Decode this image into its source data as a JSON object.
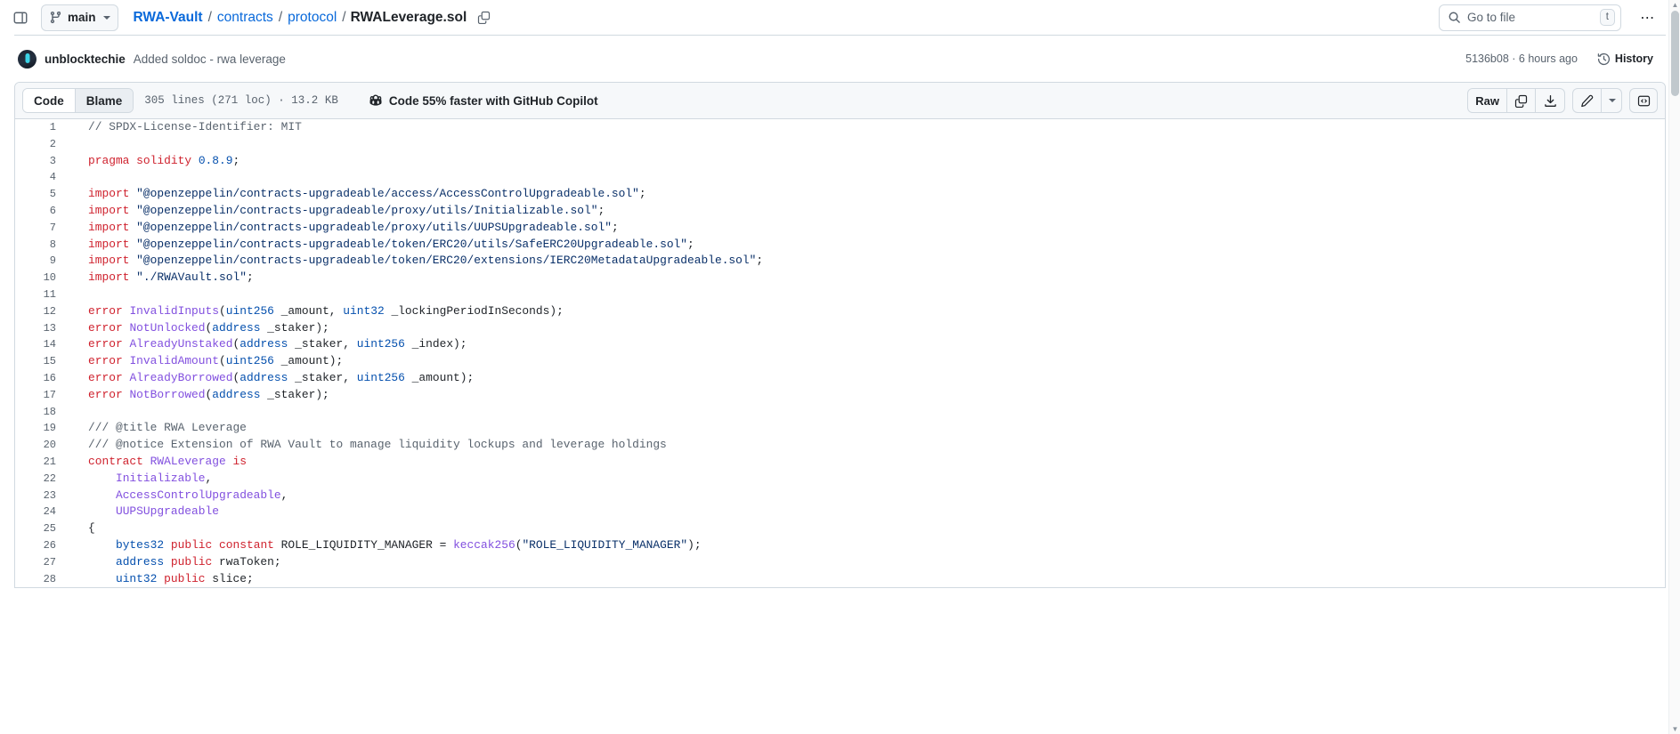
{
  "header": {
    "sidebar_toggle_name": "side-panel-icon",
    "branch": {
      "label": "main",
      "icon": "git-branch-icon"
    },
    "breadcrumb": {
      "repo": "RWA-Vault",
      "parts": [
        "contracts",
        "protocol"
      ],
      "file": "RWALeverage.sol",
      "separator": "/",
      "copy_icon": "copy-path-icon"
    },
    "search": {
      "placeholder": "Go to file",
      "shortcut": "t",
      "icon": "search-icon"
    },
    "more_label": "⋯"
  },
  "commit": {
    "author": "unblocktechie",
    "message": "Added soldoc - rwa leverage",
    "sha": "5136b08",
    "separator": "·",
    "relative_time": "6 hours ago",
    "meta": "5136b08 · 6 hours ago",
    "history_label": "History"
  },
  "file_toolbar": {
    "tabs": [
      {
        "label": "Code",
        "active": true
      },
      {
        "label": "Blame",
        "active": false
      }
    ],
    "file_meta": "305 lines (271 loc) · 13.2 KB",
    "lines_total": 305,
    "lines_loc": 271,
    "file_size": "13.2 KB",
    "copilot_banner": "Code 55% faster with GitHub Copilot",
    "actions": {
      "raw": "Raw",
      "copy": "copy-icon",
      "download": "download-icon",
      "edit": "pencil-icon",
      "edit_caret": "chevron-down-icon",
      "symbols": "code-braces-icon"
    }
  },
  "colors": {
    "accent": "#0969da",
    "keyword": "#cf222e",
    "string": "#0a3069",
    "number": "#0550ae",
    "type": "#0550ae",
    "function": "#8250df",
    "comment": "#59636e",
    "text": "#1f2328",
    "border": "#d1d9e0",
    "toolbar_bg": "#f6f8fa"
  },
  "code": {
    "language": "solidity",
    "start_line": 1,
    "lines": [
      [
        {
          "t": "cmt",
          "v": "// SPDX-License-Identifier: MIT"
        }
      ],
      [],
      [
        {
          "t": "kw",
          "v": "pragma"
        },
        {
          "t": "pln",
          "v": " "
        },
        {
          "t": "kw",
          "v": "solidity"
        },
        {
          "t": "pln",
          "v": " "
        },
        {
          "t": "num",
          "v": "0.8.9"
        },
        {
          "t": "pln",
          "v": ";"
        }
      ],
      [],
      [
        {
          "t": "kw",
          "v": "import"
        },
        {
          "t": "pln",
          "v": " "
        },
        {
          "t": "str",
          "v": "\"@openzeppelin/contracts-upgradeable/access/AccessControlUpgradeable.sol\""
        },
        {
          "t": "pln",
          "v": ";"
        }
      ],
      [
        {
          "t": "kw",
          "v": "import"
        },
        {
          "t": "pln",
          "v": " "
        },
        {
          "t": "str",
          "v": "\"@openzeppelin/contracts-upgradeable/proxy/utils/Initializable.sol\""
        },
        {
          "t": "pln",
          "v": ";"
        }
      ],
      [
        {
          "t": "kw",
          "v": "import"
        },
        {
          "t": "pln",
          "v": " "
        },
        {
          "t": "str",
          "v": "\"@openzeppelin/contracts-upgradeable/proxy/utils/UUPSUpgradeable.sol\""
        },
        {
          "t": "pln",
          "v": ";"
        }
      ],
      [
        {
          "t": "kw",
          "v": "import"
        },
        {
          "t": "pln",
          "v": " "
        },
        {
          "t": "str",
          "v": "\"@openzeppelin/contracts-upgradeable/token/ERC20/utils/SafeERC20Upgradeable.sol\""
        },
        {
          "t": "pln",
          "v": ";"
        }
      ],
      [
        {
          "t": "kw",
          "v": "import"
        },
        {
          "t": "pln",
          "v": " "
        },
        {
          "t": "str",
          "v": "\"@openzeppelin/contracts-upgradeable/token/ERC20/extensions/IERC20MetadataUpgradeable.sol\""
        },
        {
          "t": "pln",
          "v": ";"
        }
      ],
      [
        {
          "t": "kw",
          "v": "import"
        },
        {
          "t": "pln",
          "v": " "
        },
        {
          "t": "str",
          "v": "\"./RWAVault.sol\""
        },
        {
          "t": "pln",
          "v": ";"
        }
      ],
      [],
      [
        {
          "t": "kw",
          "v": "error"
        },
        {
          "t": "pln",
          "v": " "
        },
        {
          "t": "fn",
          "v": "InvalidInputs"
        },
        {
          "t": "pln",
          "v": "("
        },
        {
          "t": "typ",
          "v": "uint256"
        },
        {
          "t": "pln",
          "v": " _amount, "
        },
        {
          "t": "typ",
          "v": "uint32"
        },
        {
          "t": "pln",
          "v": " _lockingPeriodInSeconds);"
        }
      ],
      [
        {
          "t": "kw",
          "v": "error"
        },
        {
          "t": "pln",
          "v": " "
        },
        {
          "t": "fn",
          "v": "NotUnlocked"
        },
        {
          "t": "pln",
          "v": "("
        },
        {
          "t": "typ",
          "v": "address"
        },
        {
          "t": "pln",
          "v": " _staker);"
        }
      ],
      [
        {
          "t": "kw",
          "v": "error"
        },
        {
          "t": "pln",
          "v": " "
        },
        {
          "t": "fn",
          "v": "AlreadyUnstaked"
        },
        {
          "t": "pln",
          "v": "("
        },
        {
          "t": "typ",
          "v": "address"
        },
        {
          "t": "pln",
          "v": " _staker, "
        },
        {
          "t": "typ",
          "v": "uint256"
        },
        {
          "t": "pln",
          "v": " _index);"
        }
      ],
      [
        {
          "t": "kw",
          "v": "error"
        },
        {
          "t": "pln",
          "v": " "
        },
        {
          "t": "fn",
          "v": "InvalidAmount"
        },
        {
          "t": "pln",
          "v": "("
        },
        {
          "t": "typ",
          "v": "uint256"
        },
        {
          "t": "pln",
          "v": " _amount);"
        }
      ],
      [
        {
          "t": "kw",
          "v": "error"
        },
        {
          "t": "pln",
          "v": " "
        },
        {
          "t": "fn",
          "v": "AlreadyBorrowed"
        },
        {
          "t": "pln",
          "v": "("
        },
        {
          "t": "typ",
          "v": "address"
        },
        {
          "t": "pln",
          "v": " _staker, "
        },
        {
          "t": "typ",
          "v": "uint256"
        },
        {
          "t": "pln",
          "v": " _amount);"
        }
      ],
      [
        {
          "t": "kw",
          "v": "error"
        },
        {
          "t": "pln",
          "v": " "
        },
        {
          "t": "fn",
          "v": "NotBorrowed"
        },
        {
          "t": "pln",
          "v": "("
        },
        {
          "t": "typ",
          "v": "address"
        },
        {
          "t": "pln",
          "v": " _staker);"
        }
      ],
      [],
      [
        {
          "t": "cmt",
          "v": "/// @title RWA Leverage"
        }
      ],
      [
        {
          "t": "cmt",
          "v": "/// @notice Extension of RWA Vault to manage liquidity lockups and leverage holdings"
        }
      ],
      [
        {
          "t": "kw",
          "v": "contract"
        },
        {
          "t": "pln",
          "v": " "
        },
        {
          "t": "cls",
          "v": "RWALeverage"
        },
        {
          "t": "pln",
          "v": " "
        },
        {
          "t": "kw",
          "v": "is"
        }
      ],
      [
        {
          "t": "pln",
          "v": "    "
        },
        {
          "t": "cls",
          "v": "Initializable"
        },
        {
          "t": "pln",
          "v": ","
        }
      ],
      [
        {
          "t": "pln",
          "v": "    "
        },
        {
          "t": "cls",
          "v": "AccessControlUpgradeable"
        },
        {
          "t": "pln",
          "v": ","
        }
      ],
      [
        {
          "t": "pln",
          "v": "    "
        },
        {
          "t": "cls",
          "v": "UUPSUpgradeable"
        }
      ],
      [
        {
          "t": "pln",
          "v": "{"
        }
      ],
      [
        {
          "t": "pln",
          "v": "    "
        },
        {
          "t": "typ",
          "v": "bytes32"
        },
        {
          "t": "pln",
          "v": " "
        },
        {
          "t": "kw",
          "v": "public"
        },
        {
          "t": "pln",
          "v": " "
        },
        {
          "t": "kw",
          "v": "constant"
        },
        {
          "t": "pln",
          "v": " ROLE_LIQUIDITY_MANAGER = "
        },
        {
          "t": "fn",
          "v": "keccak256"
        },
        {
          "t": "pln",
          "v": "("
        },
        {
          "t": "str",
          "v": "\"ROLE_LIQUIDITY_MANAGER\""
        },
        {
          "t": "pln",
          "v": ");"
        }
      ],
      [
        {
          "t": "pln",
          "v": "    "
        },
        {
          "t": "typ",
          "v": "address"
        },
        {
          "t": "pln",
          "v": " "
        },
        {
          "t": "kw",
          "v": "public"
        },
        {
          "t": "pln",
          "v": " rwaToken;"
        }
      ],
      [
        {
          "t": "pln",
          "v": "    "
        },
        {
          "t": "typ",
          "v": "uint32"
        },
        {
          "t": "pln",
          "v": " "
        },
        {
          "t": "kw",
          "v": "public"
        },
        {
          "t": "pln",
          "v": " slice;"
        }
      ]
    ]
  },
  "scrollbar": {
    "name": "vertical-scrollbar",
    "thumb_position_pct": 0
  }
}
